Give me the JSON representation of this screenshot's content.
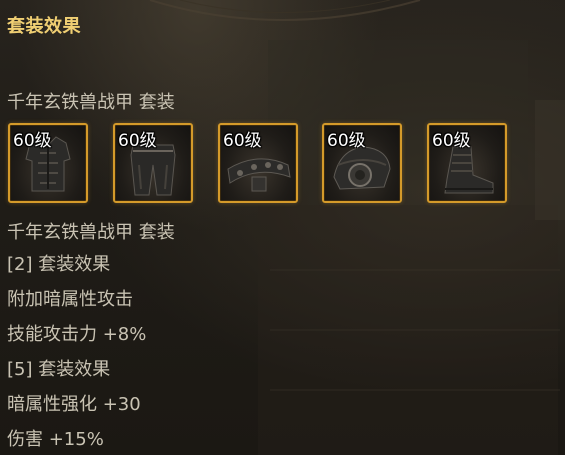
{
  "panel": {
    "title": "套装效果",
    "set_name": "千年玄铁兽战甲  套装",
    "set_name_repeat": "千年玄铁兽战甲  套装"
  },
  "items": [
    {
      "level": "60级",
      "icon": "armor-chest-icon"
    },
    {
      "level": "60级",
      "icon": "armor-legs-icon"
    },
    {
      "level": "60级",
      "icon": "armor-belt-icon"
    },
    {
      "level": "60级",
      "icon": "armor-shoulder-icon"
    },
    {
      "level": "60级",
      "icon": "armor-boots-icon"
    }
  ],
  "effects": [
    "[2] 套装效果",
    "附加暗属性攻击",
    "技能攻击力 +8%",
    "[5] 套装效果",
    "暗属性强化 +30",
    "伤害 +15%"
  ],
  "colors": {
    "title": "#f0cf73",
    "text": "#c9c3b3",
    "slot_border": "#d49a2a",
    "background": "#211e18"
  }
}
